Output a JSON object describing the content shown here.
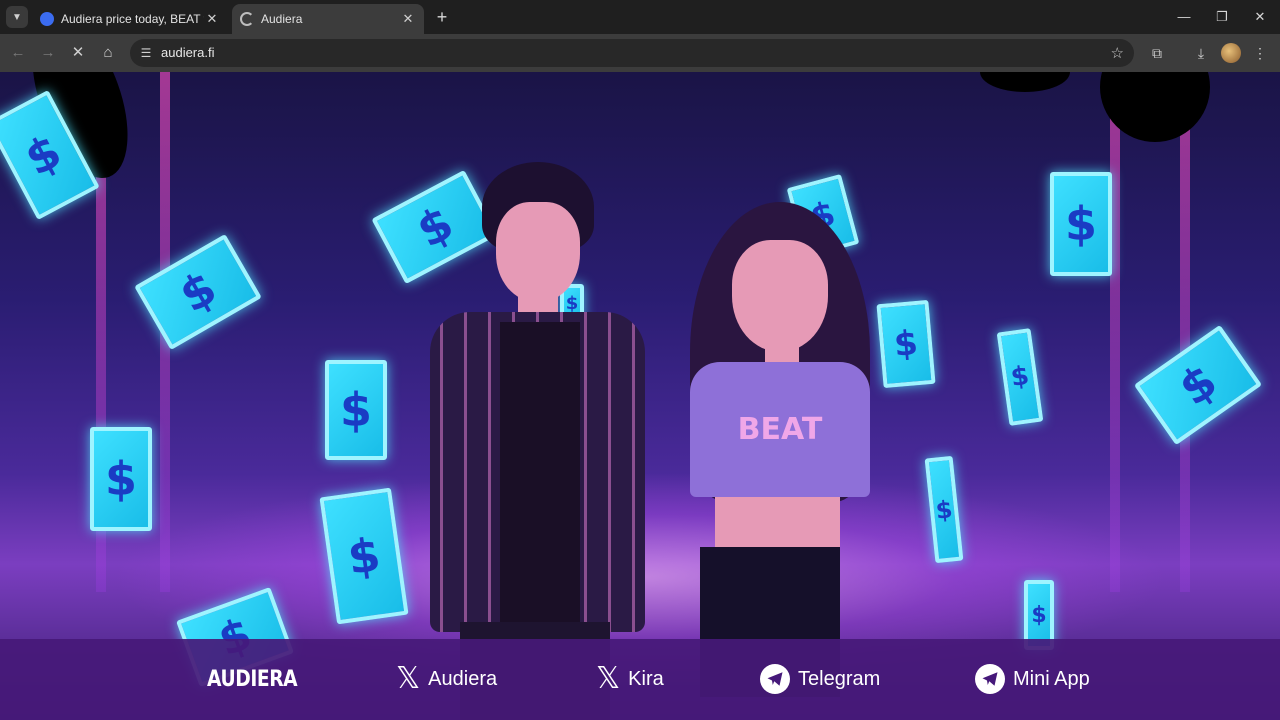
{
  "browser": {
    "tabs": [
      {
        "title": "Audiera price today, BEAT to US",
        "favicon_color": "#3b6cf0"
      },
      {
        "title": "Audiera",
        "favicon_color": "#bdbdbd"
      }
    ],
    "url": "audiera.fi"
  },
  "hero": {
    "shirt_text": "BEAT",
    "bill_symbol": "$"
  },
  "footer": {
    "brand": "AUDIERA",
    "links": [
      {
        "label": "Audiera",
        "icon": "x-icon"
      },
      {
        "label": "Kira",
        "icon": "x-icon"
      },
      {
        "label": "Telegram",
        "icon": "telegram-icon"
      },
      {
        "label": "Mini App",
        "icon": "telegram-icon"
      }
    ]
  },
  "colors": {
    "accent_bill": "#3ee0ff",
    "footer_bg": "#46197a"
  }
}
